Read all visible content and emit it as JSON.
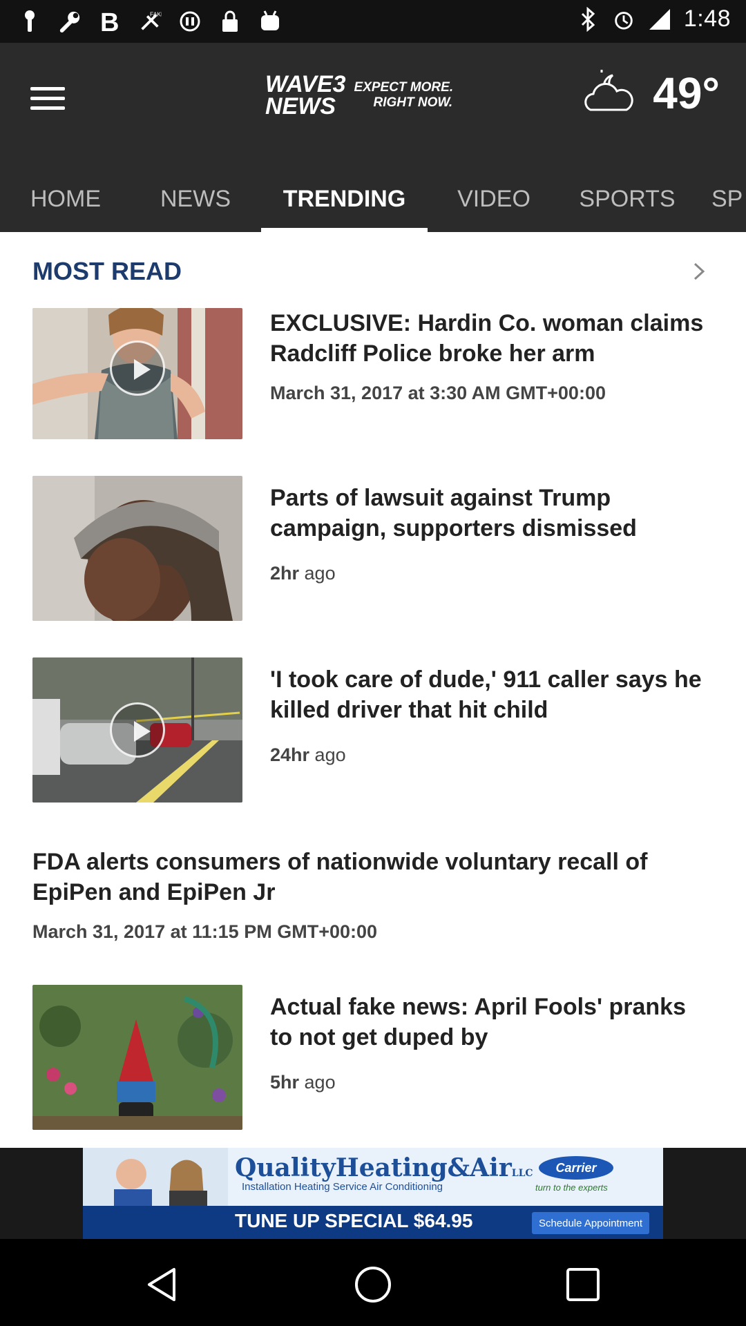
{
  "status_bar": {
    "time": "1:48",
    "left_icons": [
      "notification-pin-icon",
      "wrench-icon",
      "bold-b-icon",
      "fake-news-icon",
      "sync-off-icon",
      "lock-icon",
      "android-icon"
    ],
    "right_icons": [
      "bluetooth-icon",
      "alarm-icon",
      "signal-icon"
    ]
  },
  "header": {
    "logo_brand": "WAVE 3 NEWS",
    "logo_brand_line1": "WAVE3",
    "logo_brand_line2": "NEWS",
    "logo_tagline_1": "EXPECT MORE.",
    "logo_tagline_2": "RIGHT NOW.",
    "weather_icon": "partly-cloudy-night-icon",
    "temperature": "49°"
  },
  "tabs": [
    {
      "label": "HOME",
      "active": false
    },
    {
      "label": "NEWS",
      "active": false
    },
    {
      "label": "TRENDING",
      "active": true
    },
    {
      "label": "VIDEO",
      "active": false
    },
    {
      "label": "SPORTS",
      "active": false
    },
    {
      "label": "SP",
      "active": false
    }
  ],
  "section": {
    "title": "MOST READ"
  },
  "articles": [
    {
      "title": "EXCLUSIVE: Hardin Co. woman claims Radcliff Police broke her arm",
      "meta": "March 31, 2017 at 3:30 AM GMT+00:00",
      "has_video": true
    },
    {
      "title": "Parts of lawsuit against Trump campaign, supporters dismissed",
      "meta_strong": "2hr",
      "meta_rest": " ago",
      "has_video": false
    },
    {
      "title": "'I took care of dude,' 911 caller says he killed driver that hit child",
      "meta_strong": "24hr",
      "meta_rest": " ago",
      "has_video": true
    },
    {
      "title": "Actual fake news: April Fools' pranks to not get duped by",
      "meta_strong": "5hr",
      "meta_rest": " ago",
      "has_video": false
    }
  ],
  "full_article": {
    "title": "FDA alerts consumers of nationwide voluntary recall of EpiPen and EpiPen Jr",
    "meta": "March 31, 2017 at 11:15 PM GMT+00:00"
  },
  "ad": {
    "headline": "QualityHeating&Air",
    "headline_suffix": "LLC",
    "services": "Installation   Heating   Service   Air Conditioning",
    "carrier": "Carrier",
    "carrier_tag": "turn to the experts",
    "special": "TUNE UP SPECIAL $64.95",
    "cta": "Schedule Appointment"
  },
  "nav": {
    "back": "back-triangle-icon",
    "home": "home-circle-icon",
    "recents": "recents-square-icon"
  },
  "colors": {
    "header_bg": "#2b2b2b",
    "section_title": "#1d3b6d",
    "status_bar_bg": "#121212"
  }
}
